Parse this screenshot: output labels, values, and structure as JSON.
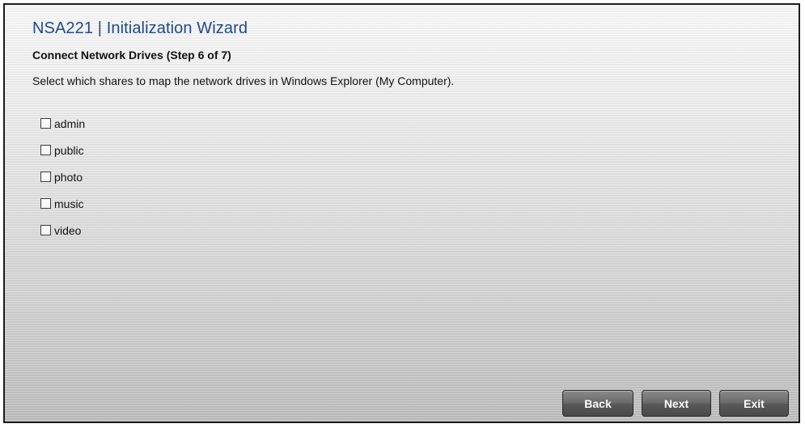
{
  "wizard": {
    "title": "NSA221 | Initialization Wizard",
    "step_title": "Connect Network Drives (Step 6 of 7)",
    "description": "Select which shares to map the network drives in Windows Explorer (My Computer)."
  },
  "shares": [
    {
      "label": "admin",
      "checked": false
    },
    {
      "label": "public",
      "checked": false
    },
    {
      "label": "photo",
      "checked": false
    },
    {
      "label": "music",
      "checked": false
    },
    {
      "label": "video",
      "checked": false
    }
  ],
  "buttons": {
    "back": "Back",
    "next": "Next",
    "exit": "Exit"
  },
  "colors": {
    "title": "#1f4a87",
    "button_bg": "#5a5a5a"
  }
}
